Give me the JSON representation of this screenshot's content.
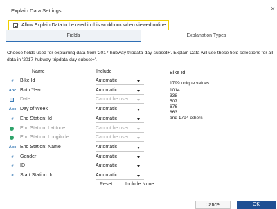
{
  "window": {
    "title": "Explain Data Settings",
    "close_glyph": "×"
  },
  "allow_option": {
    "label": "Allow Explain Data to be used in this workbook when viewed online",
    "checked": true
  },
  "tabs": [
    {
      "label": "Fields",
      "active": true
    },
    {
      "label": "Explanation Types",
      "active": false
    }
  ],
  "intro_text": "Choose fields used for explaining data from '2017-hubway-tripdata-day-subset+'. Explain Data will use these field selections for all data in '2017-hubway-tripdata-day-subset+'.",
  "columns": {
    "name": "Name",
    "include": "Include"
  },
  "fields": [
    {
      "name": "Bike Id",
      "icon": "hash-icon",
      "glyph": "#",
      "include": "Automatic",
      "enabled": true
    },
    {
      "name": "Birth Year",
      "icon": "abc-icon",
      "glyph": "Abc",
      "include": "Automatic",
      "enabled": true
    },
    {
      "name": "Date",
      "icon": "calendar-icon",
      "glyph": "",
      "include": "Cannot be used",
      "enabled": false
    },
    {
      "name": "Day of Week",
      "icon": "abc-icon",
      "glyph": "Abc",
      "include": "Automatic",
      "enabled": true
    },
    {
      "name": "End Station: Id",
      "icon": "hash-icon",
      "glyph": "#",
      "include": "Automatic",
      "enabled": true
    },
    {
      "name": "End Station: Latitude",
      "icon": "geo-icon",
      "glyph": "",
      "include": "Cannot be used",
      "enabled": false
    },
    {
      "name": "End Station: Longitude",
      "icon": "geo-icon",
      "glyph": "",
      "include": "Cannot be used",
      "enabled": false
    },
    {
      "name": "End Station: Name",
      "icon": "abc-icon",
      "glyph": "Abc",
      "include": "Automatic",
      "enabled": true
    },
    {
      "name": "Gender",
      "icon": "hash-icon",
      "glyph": "#",
      "include": "Automatic",
      "enabled": true
    },
    {
      "name": "ID",
      "icon": "hash-icon",
      "glyph": "#",
      "include": "Automatic",
      "enabled": true
    },
    {
      "name": "Start Station: Id",
      "icon": "hash-icon",
      "glyph": "#",
      "include": "Automatic",
      "enabled": true
    }
  ],
  "list_actions": {
    "reset": "Reset",
    "include_none": "Include None"
  },
  "details": {
    "field": "Bike Id",
    "unique_values": "1799 unique values",
    "values": [
      "1014",
      "338",
      "507",
      "676",
      "863",
      "and 1794 others"
    ]
  },
  "buttons": {
    "cancel": "Cancel",
    "ok": "OK"
  },
  "colors": {
    "accent": "#2f6fb5",
    "ok_button": "#1f4f93",
    "highlight_border": "#f0d000",
    "geo_icon": "#2ea36a"
  }
}
